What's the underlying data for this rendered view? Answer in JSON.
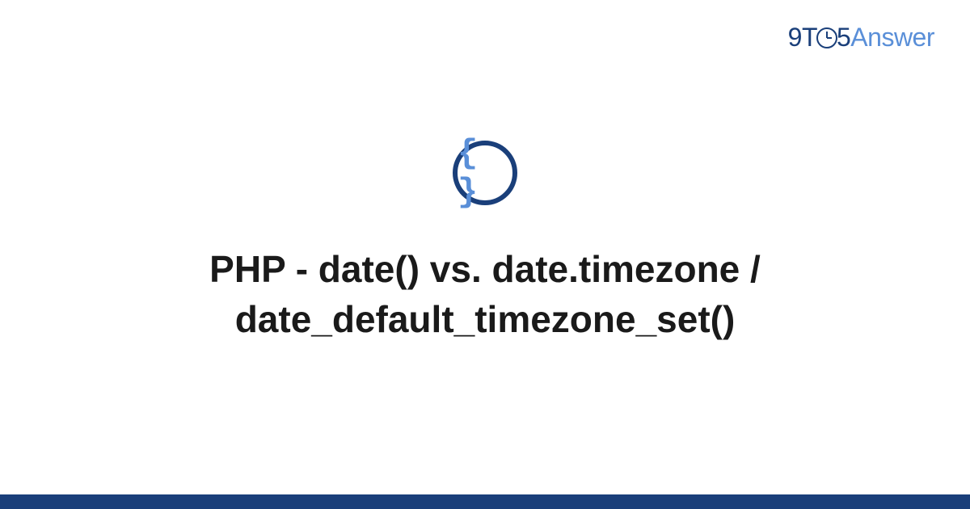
{
  "logo": {
    "part1": "9T",
    "part2": "5",
    "part3": "Answer"
  },
  "icon": {
    "glyph": "{ }"
  },
  "title": "PHP - date() vs. date.timezone / date_default_timezone_set()",
  "colors": {
    "brand_dark": "#1a3f7a",
    "brand_light": "#5a8fd8",
    "text": "#1a1a1a",
    "bg": "#ffffff"
  }
}
